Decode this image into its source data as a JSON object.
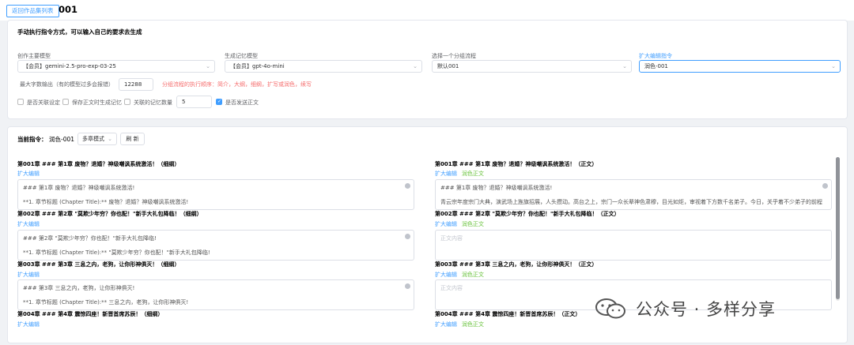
{
  "header": {
    "back_label": "返回作品集列表",
    "project_title": "001"
  },
  "settings": {
    "intro": "手动执行指令方式，可以输入自己的要求去生成",
    "main_model": {
      "label": "创作主要模型",
      "value": "【会员】gemini-2.5-pro-exp-03-25"
    },
    "memory_model": {
      "label": "生成记忆模型",
      "value": "【会员】gpt-4o-mini"
    },
    "flow": {
      "label": "选择一个分组流程",
      "value": "默认001"
    },
    "expand_cmd": {
      "label": "扩大编辑指令",
      "value": "润色-001"
    },
    "max_output": {
      "label": "最大字数输出（有的模型过多会报错）",
      "value": "12288"
    },
    "flow_order_hint": "分组流程的执行顺序：简介，大纲，细纲，扩写或润色，续写",
    "checkboxes": [
      {
        "label": "是否关联设定",
        "checked": false
      },
      {
        "label": "保存正文时生成记忆",
        "checked": false
      },
      {
        "label": "关联的记忆数量",
        "checked": false,
        "value": "5"
      },
      {
        "label": "是否发送正文",
        "checked": true
      }
    ]
  },
  "current": {
    "label": "当前指令：",
    "value": "润色-001",
    "mode": "多章模式",
    "refresh_label": "刷 新"
  },
  "left_chapters": [
    {
      "title": "第001章 ### 第1章 废物？退婚？神级嘲讽系统激活！（细纲）",
      "action": "扩大编辑",
      "line1": "### 第1章 废物？退婚？神级嘲讽系统激活!",
      "line2": "**1. 章节标题 (Chapter Title):** 废物？退婚？神级嘲讽系统激活!"
    },
    {
      "title": "第002章 ### 第2章 \"莫欺少年穷？你也配！\"新手大礼包降临！（细纲）",
      "action": "扩大编辑",
      "line1": "### 第2章 \"莫欺少年穷？你也配！\"新手大礼包降临!",
      "line2": "**1. 章节标题 (Chapter Title):** \"莫欺少年穷？你也配！\"新手大礼包降临!"
    },
    {
      "title": "第003章 ### 第3章 三息之内，老狗，让你形神俱灭！（细纲）",
      "action": "扩大编辑",
      "line1": "### 第3章 三息之内，老狗，让你形神俱灭!",
      "line2": "**1. 章节标题 (Chapter Title):** 三息之内，老狗，让你形神俱灭!"
    },
    {
      "title": "第004章 ### 第4章 震惊四座！新晋首席苏辰！（细纲）",
      "action": "扩大编辑"
    }
  ],
  "right_chapters": [
    {
      "title": "第001章 ### 第1章 废物？退婚？神级嘲讽系统激活！（正文）",
      "action1": "扩大编辑",
      "action2": "润色正文",
      "line1": "### 第1章 废物？退婚？神级嘲讽系统激活!",
      "line2": "青云宗年度宗门大典，演武场上旌旗招展，人头攒动。高台之上，宗门一众长辈神色肃穆，目光如炬，审视着下方数千名弟子。今日，关乎着不少弟子的前程"
    },
    {
      "title": "第002章 ### 第2章 \"莫欺少年穷？你也配！\"新手大礼包降临！（正文）",
      "action1": "扩大编辑",
      "action2": "润色正文",
      "placeholder": "正文内容"
    },
    {
      "title": "第003章 ### 第3章 三息之内，老狗，让你形神俱灭！（正文）",
      "action1": "扩大编辑",
      "action2": "润色正文",
      "placeholder": "正文内容"
    },
    {
      "title": "第004章 ### 第4章 震惊四座！新晋首席苏辰！（正文）",
      "action1": "扩大编辑",
      "action2": "润色正文"
    }
  ],
  "watermark": {
    "text": "公众号 · 多样分享"
  }
}
